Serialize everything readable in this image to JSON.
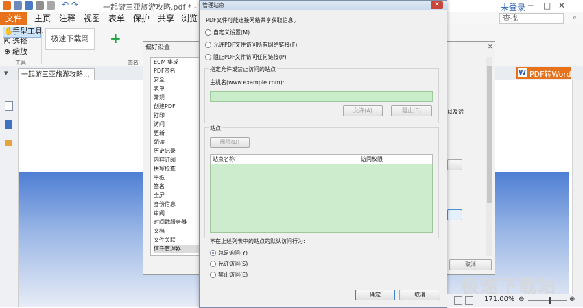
{
  "window": {
    "title": "一起游三亚旅游攻略.pdf * - 福昕",
    "login": "未登录",
    "search_placeholder": "查找"
  },
  "menu": [
    "文件",
    "主页",
    "注释",
    "视图",
    "表单",
    "保护",
    "共享",
    "浏览"
  ],
  "ribbon": {
    "hand_tool": "手型工具",
    "select": "选择",
    "zoom": "缩放",
    "group_tools": "工具",
    "group_sign": "签名",
    "site_box": "极速下载网"
  },
  "tab": {
    "doc": "一起游三亚旅游攻略..."
  },
  "pdf2word": "PDF转Word",
  "pref": {
    "title": "偏好设置",
    "items": [
      "ECM 集成",
      "PDF签名",
      "安全",
      "表单",
      "常规",
      "创建PDF",
      "打印",
      "访问",
      "更新",
      "朗读",
      "历史记录",
      "内容订阅",
      "拼写检查",
      "平板",
      "签名",
      "全屏",
      "身份信息",
      "审阅",
      "时间戳服务器",
      "文档",
      "文件关联",
      "信任管理器"
    ],
    "cancel": "取消",
    "partial_text": "以及活"
  },
  "mgr": {
    "title": "管理站点",
    "intro": "PDF文件可能连接网络共享获取信息。",
    "opt1": "自定义设置(M)",
    "opt2": "允许PDF文件访问所有网络链接(F)",
    "opt3": "阻止PDF文件访问任何链接(P)",
    "group1": "指定允许或禁止访问的站点",
    "host_label": "主机名(www.example.com):",
    "allow": "允许(A)",
    "block": "阻止(B)",
    "group2": "站点",
    "delete": "删除(D)",
    "col_site": "站点名称",
    "col_access": "访问权限",
    "default_label": "不在上述列表中的站点的默认访问行为:",
    "def1": "总是询问(Y)",
    "def2": "允许访问(S)",
    "def3": "禁止访问(E)",
    "ok": "确定",
    "cancel": "取消"
  },
  "status": {
    "zoom": "171.00%"
  },
  "watermark": "极速下载站"
}
